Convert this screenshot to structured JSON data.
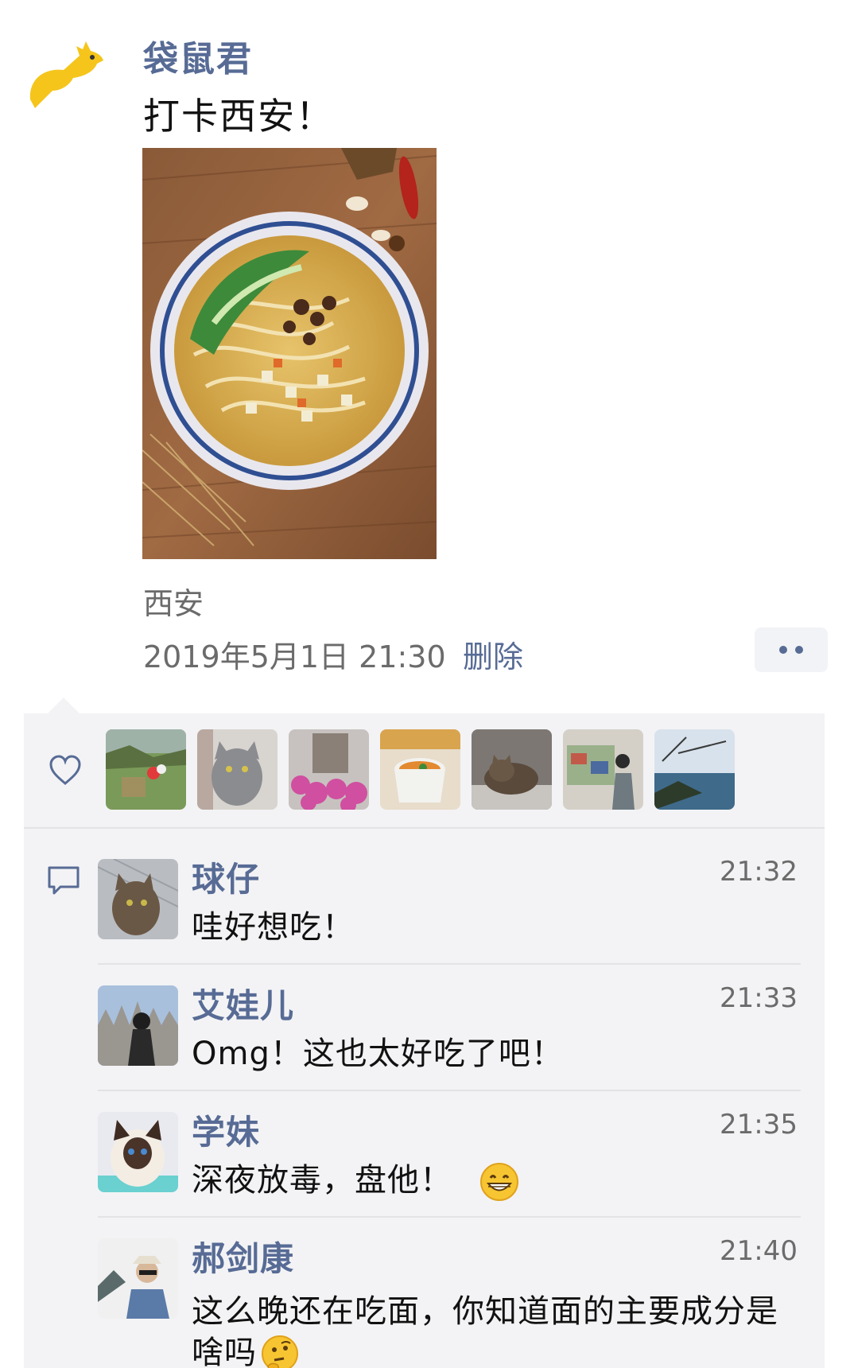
{
  "post": {
    "author": "袋鼠君",
    "text": "打卡西安！",
    "location": "西安",
    "time": "2019年5月1日 21:30",
    "delete_label": "删除",
    "photo_icon": "noodle-bowl-photo"
  },
  "likes": {
    "icon": "heart-icon",
    "avatars": [
      "paraglider-photo",
      "grey-cat-photo",
      "pink-flowers-photo",
      "soup-cup-photo",
      "tabby-cat-photo",
      "wall-poster-person-photo",
      "coast-tree-photo"
    ]
  },
  "comments": [
    {
      "name": "球仔",
      "time": "21:32",
      "text": "哇好想吃！"
    },
    {
      "name": "艾娃儿",
      "time": "21:33",
      "text": "Omg！这也太好吃了吧！"
    },
    {
      "name": "学妹",
      "time": "21:35",
      "text": "深夜放毒，盘他！",
      "emoji": "grin-emoji"
    },
    {
      "name": "郝剑康",
      "time": "21:40",
      "text": "这么晚还在吃面，你知道面的主要成分是啥吗",
      "emoji": "thinking-emoji"
    }
  ],
  "colors": {
    "link": "#576b95",
    "panel": "#f3f3f5",
    "text": "#111111",
    "muted": "#6b6b6b"
  }
}
